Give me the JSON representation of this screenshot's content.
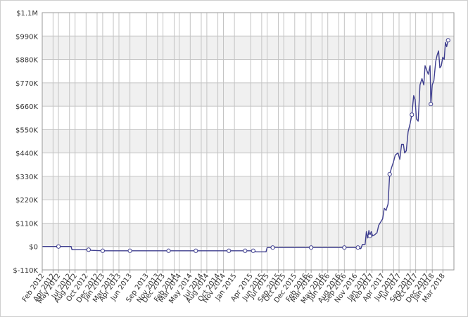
{
  "chart_data": {
    "type": "line",
    "title": "",
    "xlabel": "",
    "ylabel": "",
    "ylim": [
      -110000,
      1100000
    ],
    "y_ticks": [
      -110000,
      0,
      110000,
      220000,
      330000,
      440000,
      550000,
      660000,
      770000,
      880000,
      990000,
      1100000
    ],
    "y_tick_labels": [
      "$-110K",
      "$0",
      "$110K",
      "$220K",
      "$330K",
      "$440K",
      "$550K",
      "$660K",
      "$770K",
      "$880K",
      "$990K",
      "$1.1M"
    ],
    "x_range": [
      "2012-02-01",
      "2018-05-01"
    ],
    "x_tick_labels": [
      {
        "date": "2012-02-01",
        "label": "Feb 2012"
      },
      {
        "date": "2012-04-01",
        "label": "Apr 2012"
      },
      {
        "date": "2012-05-01",
        "label": "May 2012"
      },
      {
        "date": "2012-07-01",
        "label": "Jul 2012"
      },
      {
        "date": "2012-08-01",
        "label": "Aug 2012"
      },
      {
        "date": "2012-10-01",
        "label": "Oct 2012"
      },
      {
        "date": "2012-12-01",
        "label": "Dec 2012"
      },
      {
        "date": "2013-01-01",
        "label": "Jan 2013"
      },
      {
        "date": "2013-03-01",
        "label": "Mar 2013"
      },
      {
        "date": "2013-04-01",
        "label": "Apr 2013"
      },
      {
        "date": "2013-06-01",
        "label": "Jun 2013"
      },
      {
        "date": "2013-09-01",
        "label": "Sep 2013"
      },
      {
        "date": "2013-11-01",
        "label": "Nov 2013"
      },
      {
        "date": "2013-12-01",
        "label": "Dec 2013"
      },
      {
        "date": "2014-02-01",
        "label": "Feb 2014"
      },
      {
        "date": "2014-03-01",
        "label": "Mar 2014"
      },
      {
        "date": "2014-05-01",
        "label": "May 2014"
      },
      {
        "date": "2014-07-01",
        "label": "Jul 2014"
      },
      {
        "date": "2014-08-01",
        "label": "Aug 2014"
      },
      {
        "date": "2014-10-01",
        "label": "Oct 2014"
      },
      {
        "date": "2014-11-01",
        "label": "Nov 2014"
      },
      {
        "date": "2015-01-01",
        "label": "Jan 2015"
      },
      {
        "date": "2015-04-01",
        "label": "Apr 2015"
      },
      {
        "date": "2015-06-01",
        "label": "Jun 2015"
      },
      {
        "date": "2015-07-01",
        "label": "Jul 2015"
      },
      {
        "date": "2015-09-01",
        "label": "Sep 2015"
      },
      {
        "date": "2015-10-01",
        "label": "Oct 2015"
      },
      {
        "date": "2015-12-01",
        "label": "Dec 2015"
      },
      {
        "date": "2016-02-01",
        "label": "Feb 2016"
      },
      {
        "date": "2016-03-01",
        "label": "Mar 2016"
      },
      {
        "date": "2016-05-01",
        "label": "May 2016"
      },
      {
        "date": "2016-06-01",
        "label": "Jun 2016"
      },
      {
        "date": "2016-08-01",
        "label": "Aug 2016"
      },
      {
        "date": "2016-09-01",
        "label": "Sep 2016"
      },
      {
        "date": "2016-11-01",
        "label": "Nov 2016"
      },
      {
        "date": "2017-01-01",
        "label": "Jan 2017"
      },
      {
        "date": "2017-02-01",
        "label": "Feb 2017"
      },
      {
        "date": "2017-04-01",
        "label": "Apr 2017"
      },
      {
        "date": "2017-06-01",
        "label": "Jun 2017"
      },
      {
        "date": "2017-07-01",
        "label": "Jul 2017"
      },
      {
        "date": "2017-09-01",
        "label": "Sep 2017"
      },
      {
        "date": "2017-10-01",
        "label": "Oct 2017"
      },
      {
        "date": "2017-12-01",
        "label": "Dec 2017"
      },
      {
        "date": "2018-01-01",
        "label": "Jan 2018"
      },
      {
        "date": "2018-03-01",
        "label": "Mar 2018"
      }
    ],
    "grid": true,
    "legend": "none",
    "colors": {
      "line": "#3f3f8f",
      "marker_fill": "#ffffff",
      "band_shade": "#f0f0f0",
      "plot_bg": "#ffffff",
      "grid": "#c4c4c4",
      "tick_text": "#333333"
    },
    "series": [
      {
        "points": [
          [
            "2012-02-01",
            0
          ],
          [
            "2012-03-15",
            0
          ],
          [
            "2012-05-01",
            0
          ],
          [
            "2012-06-15",
            0
          ],
          [
            "2012-07-10",
            0
          ],
          [
            "2012-07-15",
            -15000
          ],
          [
            "2012-09-01",
            -15000
          ],
          [
            "2012-10-15",
            -15000
          ],
          [
            "2012-11-01",
            -18000
          ],
          [
            "2013-01-01",
            -20000
          ],
          [
            "2013-06-01",
            -20000
          ],
          [
            "2014-01-01",
            -20000
          ],
          [
            "2014-06-01",
            -20000
          ],
          [
            "2014-12-01",
            -20000
          ],
          [
            "2015-03-01",
            -20000
          ],
          [
            "2015-04-15",
            -20000
          ],
          [
            "2015-05-01",
            -25000
          ],
          [
            "2015-06-25",
            -25000
          ],
          [
            "2015-07-01",
            -5000
          ],
          [
            "2015-08-01",
            -5000
          ],
          [
            "2016-03-01",
            -5000
          ],
          [
            "2016-09-01",
            -5000
          ],
          [
            "2016-11-15",
            -5000
          ],
          [
            "2016-12-01",
            -10000
          ],
          [
            "2016-12-10",
            10000
          ],
          [
            "2016-12-25",
            10000
          ],
          [
            "2017-01-01",
            70000
          ],
          [
            "2017-01-08",
            40000
          ],
          [
            "2017-01-15",
            75000
          ],
          [
            "2017-01-20",
            50000
          ],
          [
            "2017-01-28",
            70000
          ],
          [
            "2017-02-05",
            50000
          ],
          [
            "2017-02-15",
            55000
          ],
          [
            "2017-03-01",
            65000
          ],
          [
            "2017-03-10",
            100000
          ],
          [
            "2017-04-01",
            130000
          ],
          [
            "2017-04-10",
            180000
          ],
          [
            "2017-04-20",
            170000
          ],
          [
            "2017-05-01",
            200000
          ],
          [
            "2017-05-10",
            340000
          ],
          [
            "2017-05-20",
            370000
          ],
          [
            "2017-06-01",
            400000
          ],
          [
            "2017-06-10",
            430000
          ],
          [
            "2017-06-25",
            440000
          ],
          [
            "2017-07-05",
            410000
          ],
          [
            "2017-07-15",
            480000
          ],
          [
            "2017-07-25",
            480000
          ],
          [
            "2017-08-01",
            440000
          ],
          [
            "2017-08-10",
            450000
          ],
          [
            "2017-08-20",
            540000
          ],
          [
            "2017-09-01",
            580000
          ],
          [
            "2017-09-10",
            620000
          ],
          [
            "2017-09-20",
            710000
          ],
          [
            "2017-09-28",
            690000
          ],
          [
            "2017-10-05",
            600000
          ],
          [
            "2017-10-15",
            590000
          ],
          [
            "2017-10-25",
            760000
          ],
          [
            "2017-11-05",
            790000
          ],
          [
            "2017-11-15",
            760000
          ],
          [
            "2017-11-22",
            850000
          ],
          [
            "2017-12-01",
            830000
          ],
          [
            "2017-12-10",
            810000
          ],
          [
            "2017-12-20",
            850000
          ],
          [
            "2017-12-24",
            670000
          ],
          [
            "2018-01-01",
            760000
          ],
          [
            "2018-01-10",
            780000
          ],
          [
            "2018-01-20",
            870000
          ],
          [
            "2018-01-28",
            900000
          ],
          [
            "2018-02-05",
            920000
          ],
          [
            "2018-02-12",
            840000
          ],
          [
            "2018-02-20",
            850000
          ],
          [
            "2018-02-28",
            890000
          ],
          [
            "2018-03-08",
            880000
          ],
          [
            "2018-03-15",
            960000
          ],
          [
            "2018-03-22",
            940000
          ],
          [
            "2018-03-30",
            970000
          ]
        ],
        "markers": [
          [
            "2012-05-01",
            0
          ],
          [
            "2012-10-15",
            -15000
          ],
          [
            "2013-01-01",
            -20000
          ],
          [
            "2013-06-01",
            -20000
          ],
          [
            "2014-01-01",
            -20000
          ],
          [
            "2014-06-01",
            -20000
          ],
          [
            "2014-12-01",
            -20000
          ],
          [
            "2015-03-01",
            -20000
          ],
          [
            "2015-04-15",
            -20000
          ],
          [
            "2015-08-01",
            -5000
          ],
          [
            "2016-03-01",
            -5000
          ],
          [
            "2016-09-01",
            -5000
          ],
          [
            "2016-11-15",
            -5000
          ],
          [
            "2017-01-20",
            50000
          ],
          [
            "2017-05-10",
            340000
          ],
          [
            "2017-09-10",
            620000
          ],
          [
            "2017-12-24",
            670000
          ],
          [
            "2018-03-30",
            970000
          ]
        ]
      }
    ]
  }
}
